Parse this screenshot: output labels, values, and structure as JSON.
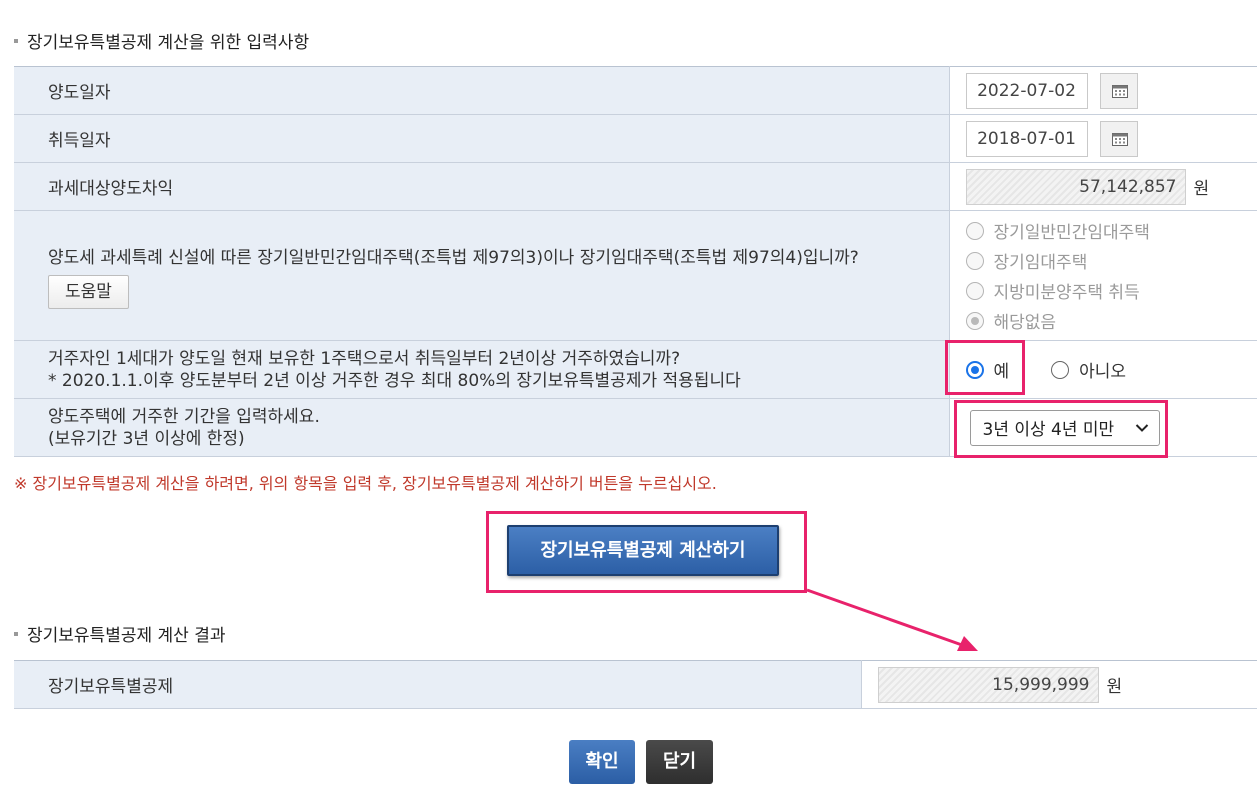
{
  "input_section": {
    "title": "장기보유특별공제 계산을 위한 입력사항",
    "transfer_date": {
      "label": "양도일자",
      "value": "2022-07-02",
      "icon": "calendar-icon"
    },
    "acquisition_date": {
      "label": "취득일자",
      "value": "2018-07-01",
      "icon": "calendar-icon"
    },
    "taxable_gain": {
      "label": "과세대상양도차익",
      "value": "57,142,857",
      "unit": "원"
    },
    "rental_question": {
      "label": "양도세 과세특례 신설에 따른 장기일반민간임대주택(조특법 제97의3)이나 장기임대주택(조특법 제97의4)입니까?",
      "help_button": "도움말",
      "options": [
        "장기일반민간임대주택",
        "장기임대주택",
        "지방미분양주택 취득",
        "해당없음"
      ],
      "selected": "해당없음"
    },
    "residence_question": {
      "label_line1": "거주자인 1세대가 양도일 현재 보유한 1주택으로서 취득일부터 2년이상 거주하였습니까?",
      "label_line2": "* 2020.1.1.이후 양도분부터 2년 이상 거주한 경우 최대 80%의 장기보유특별공제가 적용됩니다",
      "option_yes": "예",
      "option_no": "아니오",
      "selected": "예"
    },
    "residence_period": {
      "label_line1": "양도주택에 거주한 기간을 입력하세요.",
      "label_line2": "(보유기간 3년 이상에 한정)",
      "selected_value": "3년 이상 4년 미만"
    }
  },
  "notice": "※ 장기보유특별공제 계산을 하려면, 위의 항목을 입력 후, 장기보유특별공제 계산하기 버튼을 누르십시오.",
  "calc_button": "장기보유특별공제 계산하기",
  "result_section": {
    "title": "장기보유특별공제 계산 결과",
    "label": "장기보유특별공제",
    "value": "15,999,999",
    "unit": "원"
  },
  "footer": {
    "confirm": "확인",
    "close": "닫기"
  },
  "colors": {
    "highlight": "#e8226b",
    "primary_button": "#2c5fa6",
    "dark_button": "#3a3a3a",
    "label_bg": "#e8eef6"
  }
}
